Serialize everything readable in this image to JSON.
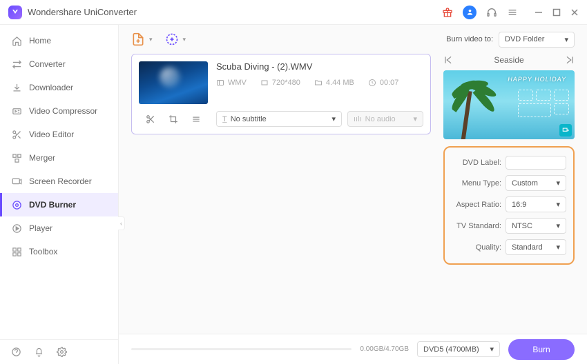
{
  "app": {
    "title": "Wondershare UniConverter"
  },
  "sidebar": {
    "items": [
      {
        "label": "Home",
        "icon": "home"
      },
      {
        "label": "Converter",
        "icon": "converter"
      },
      {
        "label": "Downloader",
        "icon": "downloader"
      },
      {
        "label": "Video Compressor",
        "icon": "compressor"
      },
      {
        "label": "Video Editor",
        "icon": "editor"
      },
      {
        "label": "Merger",
        "icon": "merger"
      },
      {
        "label": "Screen Recorder",
        "icon": "recorder"
      },
      {
        "label": "DVD Burner",
        "icon": "dvd"
      },
      {
        "label": "Player",
        "icon": "player"
      },
      {
        "label": "Toolbox",
        "icon": "toolbox"
      }
    ],
    "active_index": 7
  },
  "burn_to": {
    "label": "Burn video to:",
    "value": "DVD Folder"
  },
  "file": {
    "name": "Scuba Diving - (2).WMV",
    "format": "WMV",
    "resolution": "720*480",
    "size": "4.44 MB",
    "duration": "00:07",
    "subtitle": "No subtitle",
    "audio": "No audio"
  },
  "template": {
    "name": "Seaside",
    "banner": "HAPPY HOLIDAY"
  },
  "settings": {
    "dvd_label": {
      "label": "DVD Label:",
      "value": ""
    },
    "menu_type": {
      "label": "Menu Type:",
      "value": "Custom"
    },
    "aspect_ratio": {
      "label": "Aspect Ratio:",
      "value": "16:9"
    },
    "tv_standard": {
      "label": "TV Standard:",
      "value": "NTSC"
    },
    "quality": {
      "label": "Quality:",
      "value": "Standard"
    }
  },
  "footer": {
    "size_text": "0.00GB/4.70GB",
    "disc_type": "DVD5 (4700MB)",
    "burn_label": "Burn"
  }
}
